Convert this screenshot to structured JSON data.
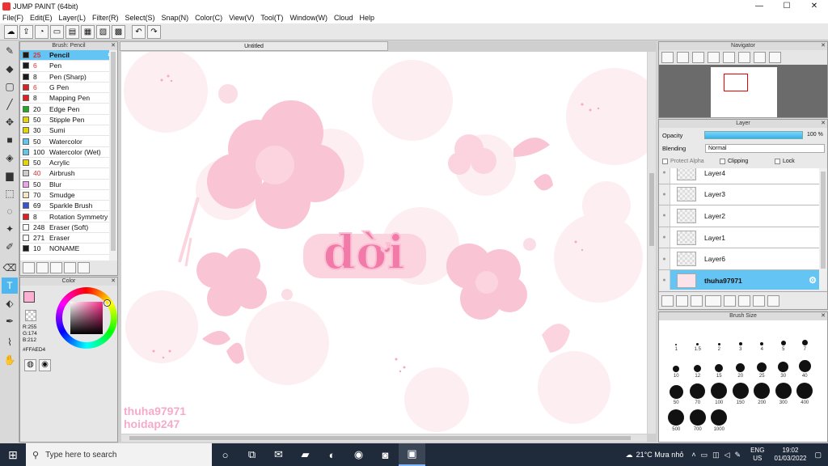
{
  "window": {
    "title": "JUMP PAINT (64bit)",
    "min": "—",
    "max": "☐",
    "close": "✕"
  },
  "menu": [
    "File(F)",
    "Edit(E)",
    "Layer(L)",
    "Filter(R)",
    "Select(S)",
    "Snap(N)",
    "Color(C)",
    "View(V)",
    "Tool(T)",
    "Window(W)",
    "Cloud",
    "Help"
  ],
  "brush_panel": {
    "title": "Brush: Pencil",
    "items": [
      {
        "size": "25",
        "name": "Pencil",
        "color": "#1a1a1a",
        "selected": true,
        "size_red": true
      },
      {
        "size": "6",
        "name": "Pen",
        "color": "#1a1a1a",
        "size_red": true
      },
      {
        "size": "8",
        "name": "Pen (Sharp)",
        "color": "#1a1a1a"
      },
      {
        "size": "6",
        "name": "G Pen",
        "color": "#e02020",
        "size_red": true
      },
      {
        "size": "8",
        "name": "Mapping Pen",
        "color": "#e02020"
      },
      {
        "size": "20",
        "name": "Edge Pen",
        "color": "#22aa22"
      },
      {
        "size": "50",
        "name": "Stipple Pen",
        "color": "#e8d400"
      },
      {
        "size": "30",
        "name": "Sumi",
        "color": "#e8d400"
      },
      {
        "size": "50",
        "name": "Watercolor",
        "color": "#5cc8f0"
      },
      {
        "size": "100",
        "name": "Watercolor (Wet)",
        "color": "#5cc8f0"
      },
      {
        "size": "50",
        "name": "Acrylic",
        "color": "#e8d400"
      },
      {
        "size": "40",
        "name": "Airbrush",
        "color": "#cccccc",
        "size_red": true
      },
      {
        "size": "50",
        "name": "Blur",
        "color": "#f0a0f0"
      },
      {
        "size": "70",
        "name": "Smudge",
        "color": "#f5e6c8"
      },
      {
        "size": "69",
        "name": "Sparkle Brush",
        "color": "#3355dd"
      },
      {
        "size": "8",
        "name": "Rotation Symmetry",
        "color": "#e02020"
      },
      {
        "size": "248",
        "name": "Eraser (Soft)",
        "color": "#ffffff"
      },
      {
        "size": "271",
        "name": "Eraser",
        "color": "#ffffff"
      },
      {
        "size": "10",
        "name": "NONAME",
        "color": "#1a1a1a"
      }
    ]
  },
  "color_panel": {
    "title": "Color",
    "r": "R:255",
    "g": "G:174",
    "b": "B:212",
    "hex": "#FFAED4",
    "fg": "#ffaed4"
  },
  "document": {
    "tab": "Untitled"
  },
  "canvas": {
    "main_text": "dời",
    "wm1": "thuha97971",
    "wm2": "hoidap247"
  },
  "navigator": {
    "title": "Navigator"
  },
  "layer_panel": {
    "title": "Layer",
    "opacity_label": "Opacity",
    "opacity_value": "100 %",
    "blending_label": "Blending",
    "blending_value": "Normal",
    "protect_alpha": "Protect Alpha",
    "clipping": "Clipping",
    "lock": "Lock",
    "layers": [
      {
        "name": "Layer4"
      },
      {
        "name": "Layer3"
      },
      {
        "name": "Layer2"
      },
      {
        "name": "Layer1"
      },
      {
        "name": "Layer6"
      },
      {
        "name": "thuha97971",
        "selected": true
      }
    ]
  },
  "brush_size": {
    "title": "Brush Size",
    "sizes": [
      "1",
      "1.5",
      "2",
      "3",
      "4",
      "5",
      "7",
      "10",
      "12",
      "15",
      "20",
      "25",
      "30",
      "40",
      "50",
      "70",
      "100",
      "150",
      "200",
      "300",
      "400",
      "500",
      "700",
      "1000"
    ]
  },
  "taskbar": {
    "search": "Type here to search",
    "weather": "21°C  Mưa nhỏ",
    "lang1": "ENG",
    "lang2": "US",
    "time": "19:02",
    "date": "01/03/2022"
  }
}
